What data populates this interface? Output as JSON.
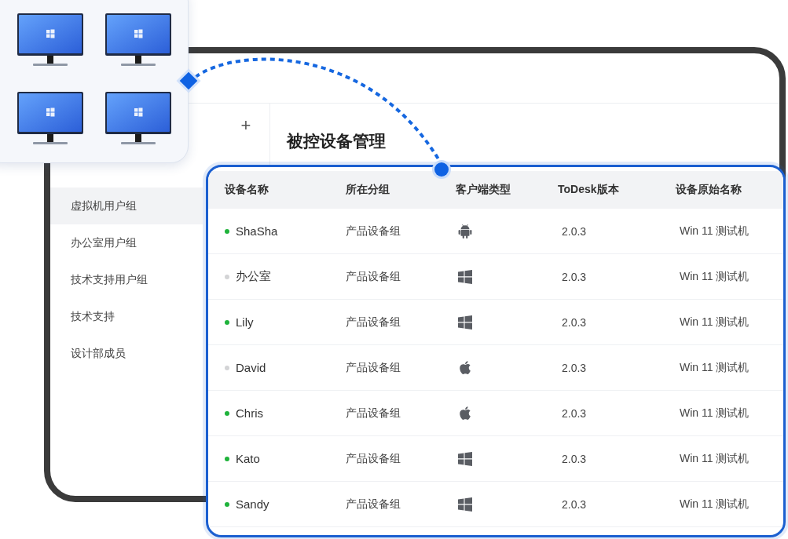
{
  "sidebar": {
    "add_label": "+",
    "items": [
      {
        "label": "虚拟机用户组",
        "selected": true
      },
      {
        "label": "办公室用户组",
        "selected": false
      },
      {
        "label": "技术支持用户组",
        "selected": false
      },
      {
        "label": "技术支持",
        "selected": false
      },
      {
        "label": "设计部成员",
        "selected": false
      }
    ]
  },
  "page_title": "被控设备管理",
  "table": {
    "columns": [
      "设备名称",
      "所在分组",
      "客户端类型",
      "ToDesk版本",
      "设备原始名称"
    ],
    "rows": [
      {
        "name": "ShaSha",
        "online": true,
        "group": "产品设备组",
        "kind": "android",
        "version": "2.0.3",
        "original_name": "Win 11 测试机"
      },
      {
        "name": "办公室",
        "online": false,
        "group": "产品设备组",
        "kind": "windows",
        "version": "2.0.3",
        "original_name": "Win 11 测试机"
      },
      {
        "name": "Lily",
        "online": true,
        "group": "产品设备组",
        "kind": "windows",
        "version": "2.0.3",
        "original_name": "Win 11 测试机"
      },
      {
        "name": "David",
        "online": false,
        "group": "产品设备组",
        "kind": "apple",
        "version": "2.0.3",
        "original_name": "Win 11 测试机"
      },
      {
        "name": "Chris",
        "online": true,
        "group": "产品设备组",
        "kind": "apple",
        "version": "2.0.3",
        "original_name": "Win 11 测试机"
      },
      {
        "name": "Kato",
        "online": true,
        "group": "产品设备组",
        "kind": "windows",
        "version": "2.0.3",
        "original_name": "Win 11 测试机"
      },
      {
        "name": "Sandy",
        "online": true,
        "group": "产品设备组",
        "kind": "windows",
        "version": "2.0.3",
        "original_name": "Win 11 测试机"
      }
    ]
  }
}
